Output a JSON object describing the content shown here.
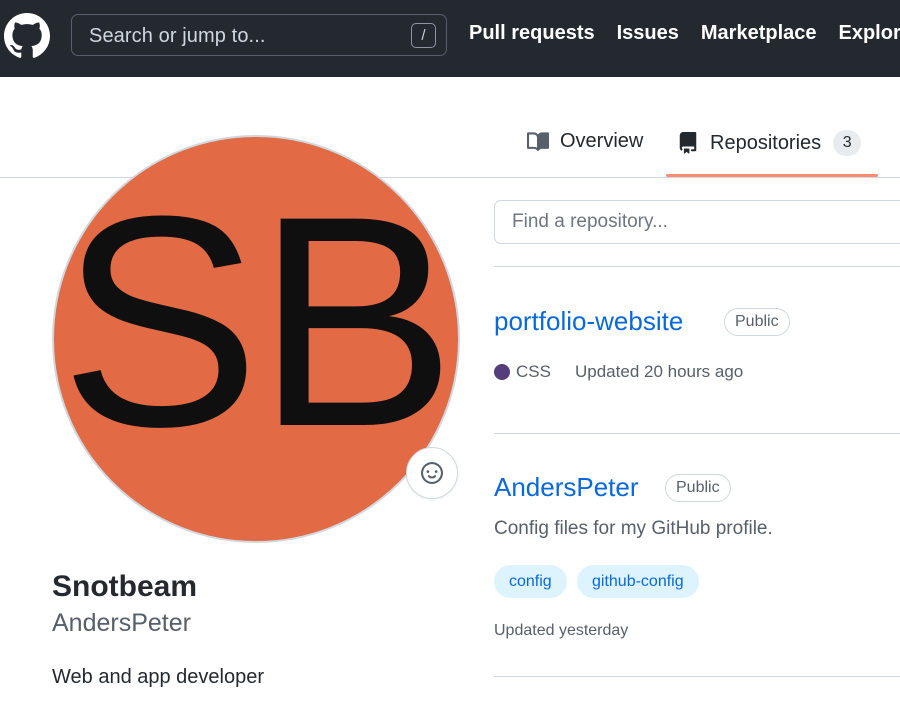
{
  "header": {
    "search_placeholder": "Search or jump to...",
    "search_shortcut": "/",
    "nav": [
      "Pull requests",
      "Issues",
      "Marketplace",
      "Explore"
    ],
    "bg_color": "#24292f"
  },
  "tabs": {
    "overview": {
      "label": "Overview",
      "icon": "book-icon"
    },
    "repositories": {
      "label": "Repositories",
      "count": "3",
      "icon": "repo-icon",
      "selected": true
    },
    "accent_color": "#fd8c73"
  },
  "profile": {
    "avatar_initials": "SB",
    "avatar_color": "#e26a45",
    "display_name": "Snotbeam",
    "username": "AndersPeter",
    "bio": "Web and app developer",
    "status_icon": "smiley-icon"
  },
  "repositories": {
    "search_placeholder": "Find a repository...",
    "items": [
      {
        "name": "portfolio-website",
        "visibility": "Public",
        "language": "CSS",
        "language_color": "#563d7c",
        "updated": "Updated 20 hours ago"
      },
      {
        "name": "AndersPeter",
        "visibility": "Public",
        "description": "Config files for my GitHub profile.",
        "topics": [
          "config",
          "github-config"
        ],
        "updated": "Updated yesterday"
      }
    ]
  }
}
